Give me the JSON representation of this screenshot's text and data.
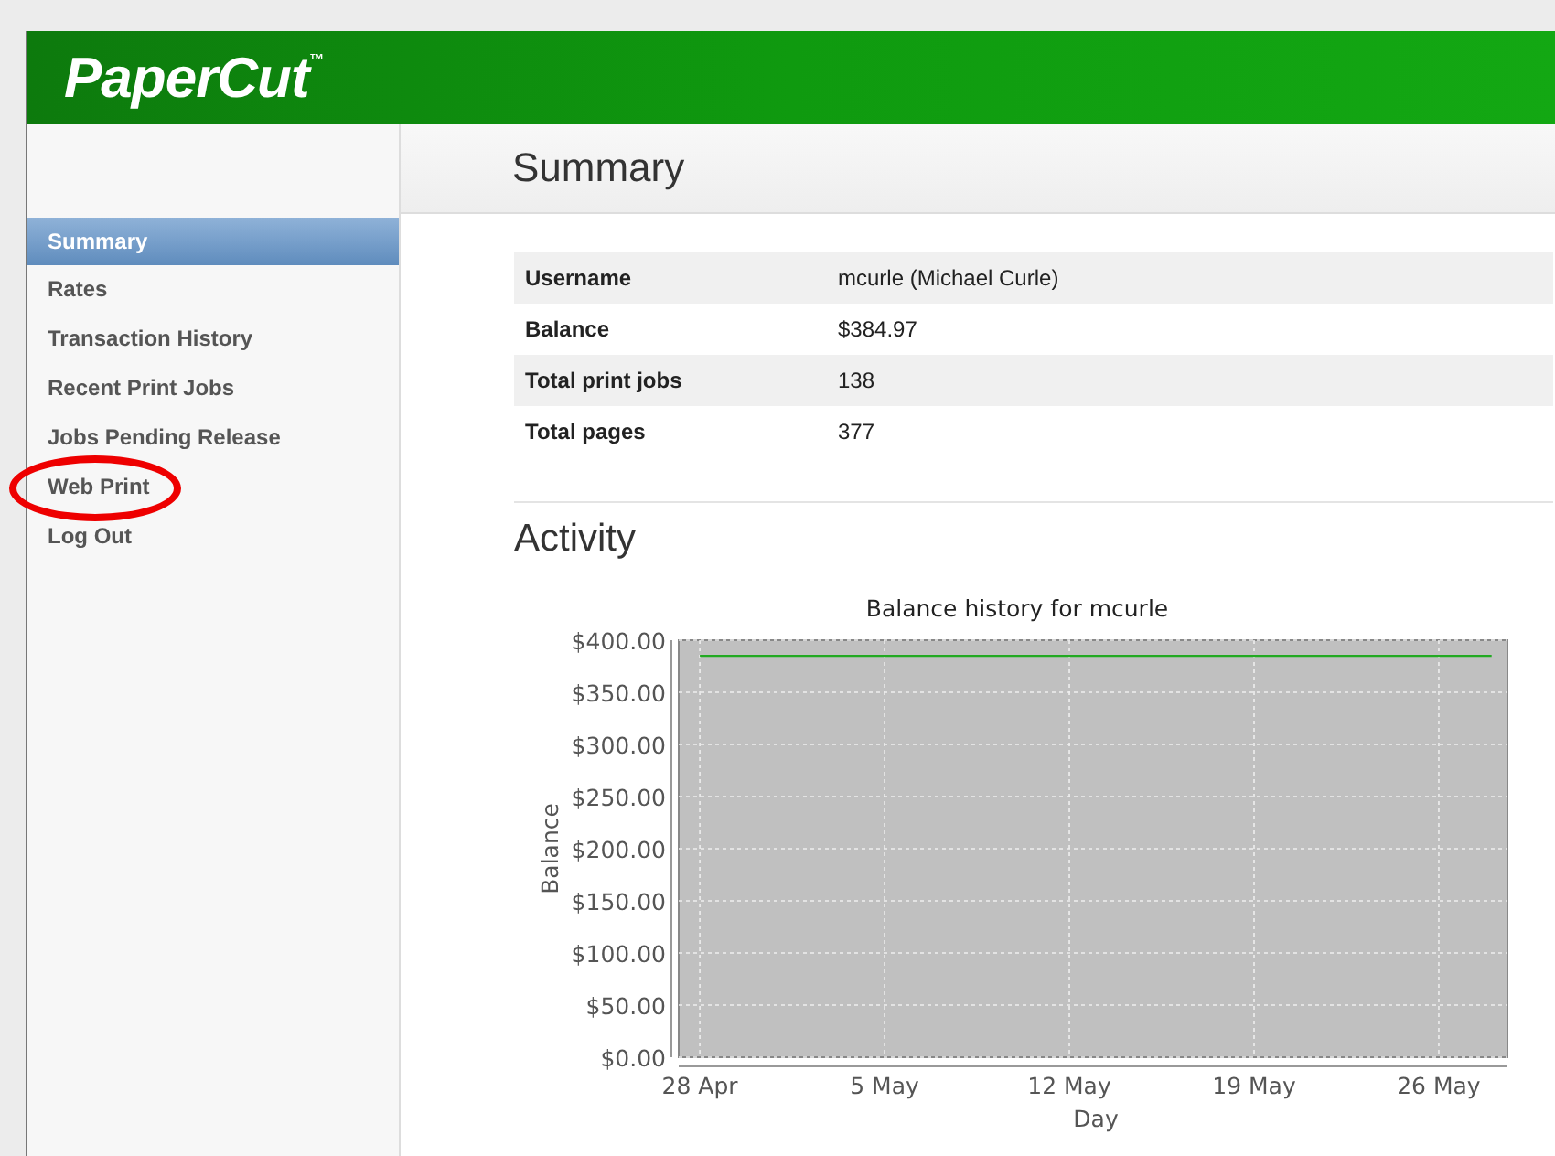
{
  "header": {
    "logo": "PaperCut$^{™}$"
  },
  "sidebar": {
    "items": [
      {
        "label": "Summary",
        "selected": true,
        "circled": false
      },
      {
        "label": "Rates",
        "selected": false,
        "circled": false
      },
      {
        "label": "Transaction History",
        "selected": false,
        "circled": false
      },
      {
        "label": "Recent Print Jobs",
        "selected": false,
        "circled": false
      },
      {
        "label": "Jobs Pending Release",
        "selected": false,
        "circled": false
      },
      {
        "label": "Web Print",
        "selected": false,
        "circled": true
      },
      {
        "label": "Log Out",
        "selected": false,
        "circled": false
      }
    ]
  },
  "main": {
    "title": "Summary",
    "summary_table": {
      "rows": [
        {
          "label": "Username",
          "value": "mcurle (Michael Curle)"
        },
        {
          "label": "Balance",
          "value": "$384.97"
        },
        {
          "label": "Total print jobs",
          "value": "138"
        },
        {
          "label": "Total pages",
          "value": "377"
        }
      ]
    },
    "activity": {
      "title": "Activity",
      "chart_data": {
        "type": "line",
        "title": "Balance history for mcurle",
        "xlabel": "Day",
        "ylabel": "Balance",
        "categories": [
          "28 Apr",
          null,
          null,
          null,
          null,
          null,
          null,
          "5 May",
          null,
          null,
          null,
          null,
          null,
          null,
          "12 May",
          null,
          null,
          null,
          null,
          null,
          null,
          "19 May",
          null,
          null,
          null,
          null,
          null,
          null,
          "26 May",
          null,
          null
        ],
        "series": [
          {
            "color": "#22aa22",
            "values": [
              385,
              385,
              385,
              385,
              385,
              385,
              385,
              385,
              385,
              385,
              385,
              385,
              385,
              385,
              385,
              385,
              385,
              385,
              385,
              385,
              385,
              385,
              385,
              385,
              385,
              385,
              385,
              385,
              385,
              385,
              385
            ]
          }
        ],
        "grid": true,
        "ylim": [
          0,
          400
        ],
        "yticks": [
          {
            "value": 0,
            "label": "$0.00"
          },
          {
            "value": 50,
            "label": "$50.00"
          },
          {
            "value": 100,
            "label": "$100.00"
          },
          {
            "value": 150,
            "label": "$150.00"
          },
          {
            "value": 200,
            "label": "$200.00"
          },
          {
            "value": 250,
            "label": "$250.00"
          },
          {
            "value": 300,
            "label": "$300.00"
          },
          {
            "value": 350,
            "label": "$350.00"
          },
          {
            "value": 400,
            "label": "$400.00"
          }
        ]
      }
    }
  }
}
